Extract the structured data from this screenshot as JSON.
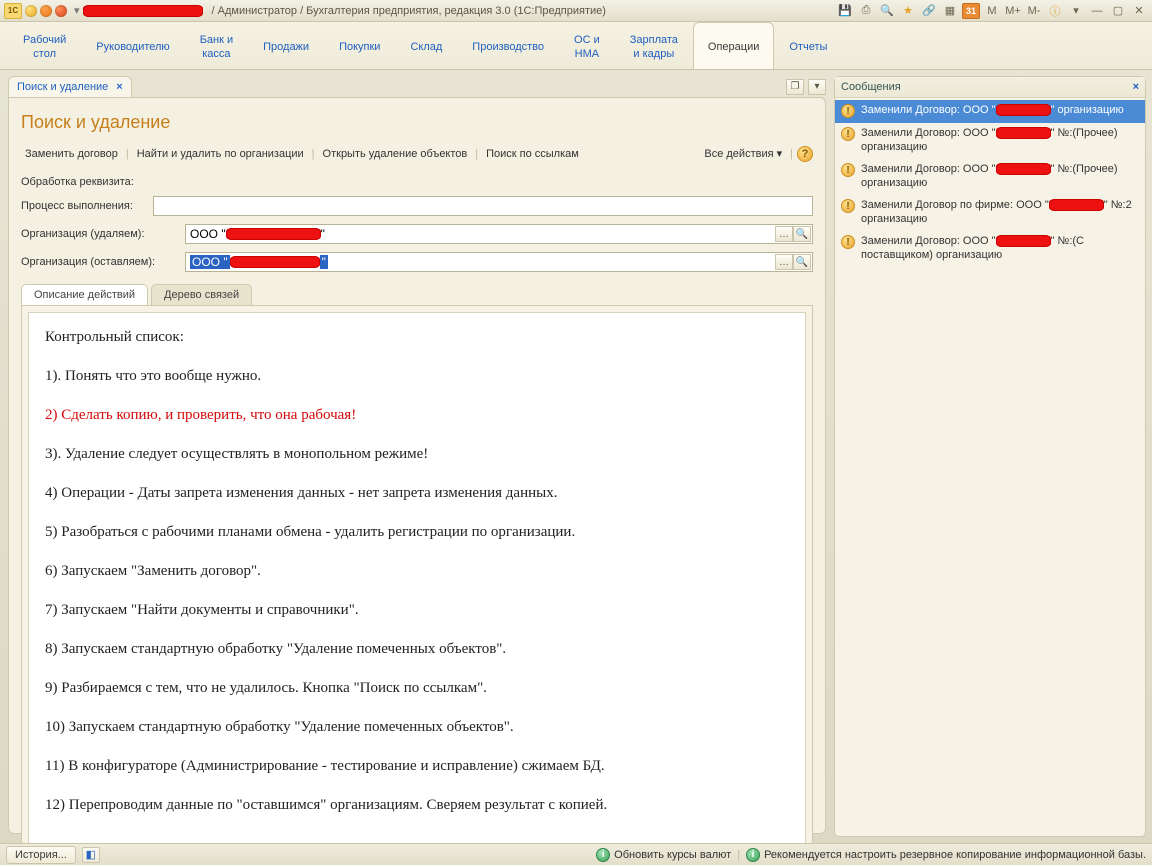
{
  "window": {
    "title_suffix": " / Администратор / Бухгалтерия предприятия, редакция 3.0  (1С:Предприятие)"
  },
  "nav": {
    "items": [
      "Рабочий\nстол",
      "Руководителю",
      "Банк и\nкасса",
      "Продажи",
      "Покупки",
      "Склад",
      "Производство",
      "ОС и\nНМА",
      "Зарплата\nи кадры",
      "Операции",
      "Отчеты"
    ],
    "active_index": 9
  },
  "doc_tab": {
    "label": "Поиск и удаление"
  },
  "page_title": "Поиск и удаление",
  "cmdbar": {
    "items": [
      "Заменить договор",
      "Найти и удалить по организации",
      "Открыть удаление объектов",
      "Поиск по ссылкам"
    ],
    "all_actions": "Все действия"
  },
  "labels": {
    "processing": "Обработка реквизита:",
    "progress": "Процесс выполнения:",
    "org_remove": "Организация (удаляем):",
    "org_keep": "Организация (оставляем):"
  },
  "fields": {
    "org_remove_prefix": "ООО \"",
    "org_remove_suffix": "\"",
    "org_keep_prefix": "ООО \"",
    "org_keep_suffix": "\""
  },
  "inner_tabs": {
    "desc": "Описание действий",
    "tree": "Дерево связей"
  },
  "desc": {
    "heading": "Контрольный список:",
    "items": [
      {
        "text": "1). Понять что это вообще нужно."
      },
      {
        "text": "2) Сделать копию, и проверить, что она рабочая!",
        "red": true
      },
      {
        "text": "3). Удаление следует осуществлять в монопольном режиме!"
      },
      {
        "text": "4) Операции - Даты запрета изменения данных - нет запрета изменения данных."
      },
      {
        "text": "5) Разобраться с рабочими планами обмена - удалить регистрации по организации."
      },
      {
        "text": "6) Запускаем \"Заменить договор\"."
      },
      {
        "text": "7) Запускаем \"Найти документы и справочники\"."
      },
      {
        "text": "8) Запускаем стандартную обработку \"Удаление помеченных объектов\"."
      },
      {
        "text": "9) Разбираемся с тем, что не удалилось. Кнопка \"Поиск по ссылкам\"."
      },
      {
        "text": "10) Запускаем стандартную обработку \"Удаление помеченных объектов\"."
      },
      {
        "text": "11) В конфигураторе (Администрирование - тестирование и исправление) сжимаем БД."
      },
      {
        "text": "12) Перепроводим данные по \"оставшимся\" организациям. Сверяем результат с копией."
      }
    ]
  },
  "messages": {
    "title": "Сообщения",
    "items": [
      {
        "before": "Заменили Договор: ООО \"",
        "after": "\" организацию",
        "selected": true
      },
      {
        "before": "Заменили Договор: ООО \"",
        "after": "\" №:(Прочее) организацию"
      },
      {
        "before": "Заменили Договор: ООО \"",
        "after": "\" №:(Прочее) организацию"
      },
      {
        "before": "Заменили Договор по фирме: ООО \"",
        "after": "\" №:2 организацию"
      },
      {
        "before": "Заменили Договор: ООО \"",
        "after": "\" №:(С поставщиком) организацию"
      }
    ]
  },
  "statusbar": {
    "history": "История...",
    "refresh_rates": "Обновить курсы валют",
    "recommend": "Рекомендуется настроить резервное копирование информационной базы."
  },
  "toolbar_letters": {
    "m": "M",
    "mplus": "M+",
    "mminus": "M-"
  }
}
